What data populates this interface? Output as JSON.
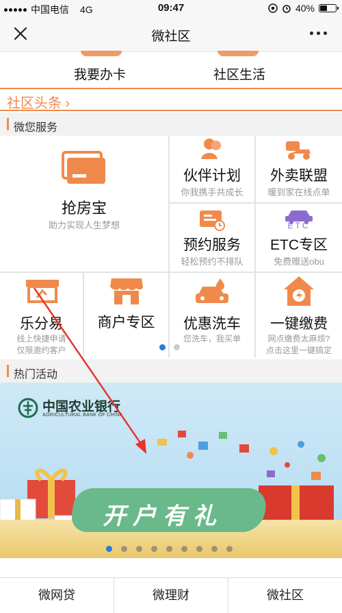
{
  "status": {
    "carrier": "中国电信",
    "network": "4G",
    "time": "09:47",
    "battery": "40%"
  },
  "nav": {
    "title": "微社区"
  },
  "top_links": [
    {
      "label": "我要办卡"
    },
    {
      "label": "社区生活"
    }
  ],
  "headline": {
    "label": "社区头条 ›"
  },
  "services": {
    "header": "微您服务",
    "main": {
      "title": "抢房宝",
      "subtitle": "助力实现人生梦想"
    },
    "items": [
      {
        "title": "伙伴计划",
        "subtitle": "你我携手共成长"
      },
      {
        "title": "外卖联盟",
        "subtitle": "暖到家在线点单"
      },
      {
        "title": "预约服务",
        "subtitle": "轻松预约不排队"
      },
      {
        "title": "ETC专区",
        "subtitle": "免费赠送obu"
      }
    ],
    "row2": [
      {
        "title": "乐分易",
        "subtitle": "线上快捷申请\n仅限邀约客户"
      },
      {
        "title": "商户专区",
        "subtitle": ""
      },
      {
        "title": "优惠洗车",
        "subtitle": "您洗车，我买单"
      },
      {
        "title": "一键缴费",
        "subtitle": "网点缴费太麻烦?\n点击这里一键搞定"
      }
    ],
    "etc_badge": "ETC"
  },
  "activities": {
    "header": "热门活动",
    "bank_name": "中国农业银行",
    "bank_name_en": "AGRICULTURAL BANK OF CHINA",
    "promo_text": "开户有礼",
    "slide_count": 9,
    "active_slide": 0
  },
  "tabs": [
    {
      "label": "微网贷"
    },
    {
      "label": "微理财"
    },
    {
      "label": "微社区"
    }
  ],
  "colors": {
    "accent": "#f08a4b",
    "indicator": "#2b7bd8",
    "annotation": "#e8342b"
  }
}
